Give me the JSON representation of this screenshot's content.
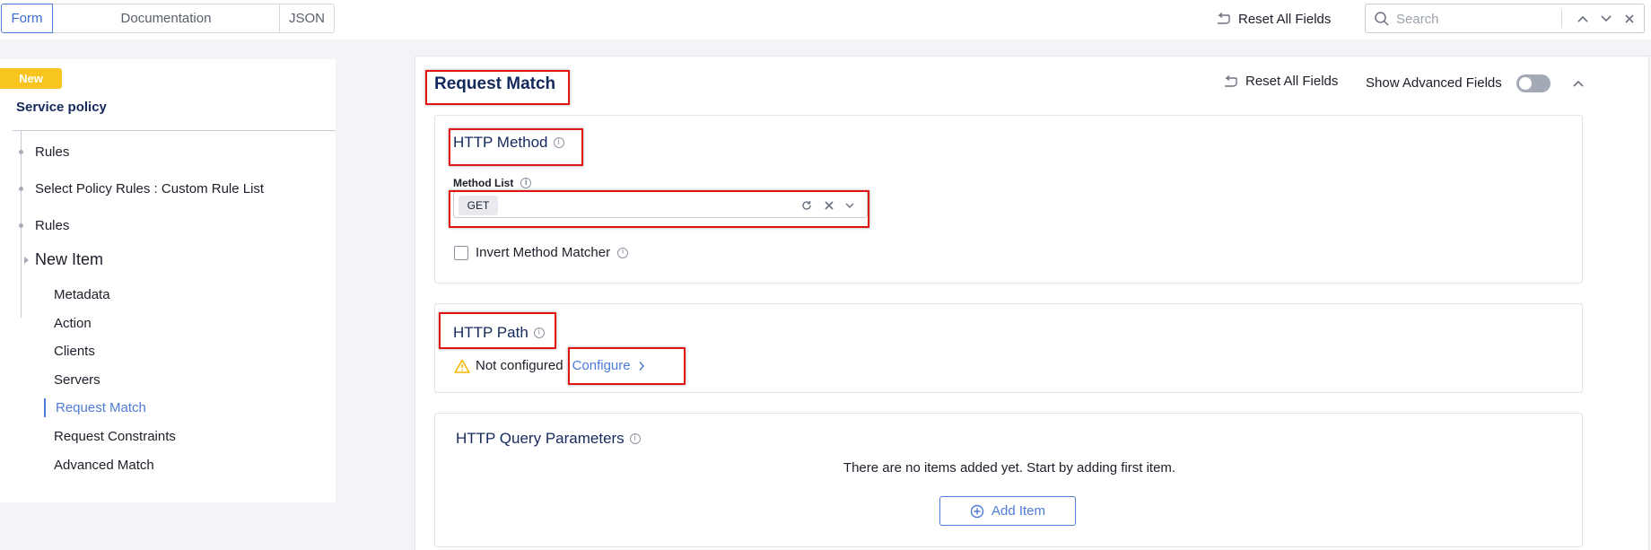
{
  "toolbar": {
    "tabs": [
      "Form",
      "Documentation",
      "JSON"
    ],
    "reset_label": "Reset All Fields",
    "search_placeholder": "Search"
  },
  "sidebar": {
    "badge": "New",
    "title": "Service policy",
    "tree": [
      "Rules",
      "Select Policy Rules : Custom Rule List",
      "Rules"
    ],
    "current": "New Item",
    "items": [
      "Metadata",
      "Action",
      "Clients",
      "Servers",
      "Request Match",
      "Request Constraints",
      "Advanced Match"
    ],
    "active_item": "Request Match"
  },
  "main": {
    "title": "Request Match",
    "reset_label": "Reset All Fields",
    "advanced_label": "Show Advanced Fields",
    "advanced_enabled": false,
    "http_method": {
      "title": "HTTP Method",
      "field_label": "Method List",
      "selected": [
        "GET"
      ],
      "checkbox_label": "Invert Method Matcher",
      "checked": false
    },
    "http_path": {
      "title": "HTTP Path",
      "status": "Not configured",
      "configure_label": "Configure"
    },
    "query_params": {
      "title": "HTTP Query Parameters",
      "empty_text": "There are no items added yet. Start by adding first item.",
      "add_label": "Add Item"
    }
  },
  "colors": {
    "accent": "#4e7bd6",
    "badge": "#f7c51e",
    "highlight": "#e01414",
    "title": "#152a5c"
  }
}
